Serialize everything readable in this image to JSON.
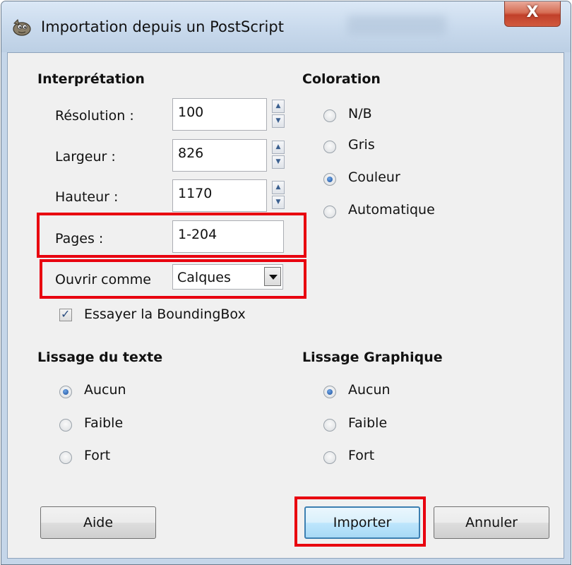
{
  "window": {
    "title": "Importation depuis un PostScript",
    "close_label": "X"
  },
  "interpretation": {
    "heading": "Interprétation",
    "resolution": {
      "label": "Résolution :",
      "value": "100"
    },
    "width": {
      "label": "Largeur :",
      "value": "826"
    },
    "height": {
      "label": "Hauteur :",
      "value": "1170"
    },
    "pages": {
      "label": "Pages :",
      "value": "1-204"
    },
    "open_as": {
      "label": "Ouvrir comme",
      "value": "Calques"
    },
    "bounding_box": {
      "label": "Essayer la BoundingBox",
      "checked": true
    }
  },
  "coloration": {
    "heading": "Coloration",
    "options": [
      "N/B",
      "Gris",
      "Couleur",
      "Automatique"
    ],
    "selected": "Couleur"
  },
  "text_smoothing": {
    "heading": "Lissage du texte",
    "options": [
      "Aucun",
      "Faible",
      "Fort"
    ],
    "selected": "Aucun"
  },
  "graphic_smoothing": {
    "heading": "Lissage Graphique",
    "options": [
      "Aucun",
      "Faible",
      "Fort"
    ],
    "selected": "Aucun"
  },
  "buttons": {
    "help": "Aide",
    "import": "Importer",
    "cancel": "Annuler"
  },
  "colors": {
    "highlight": "#e8000f",
    "accent": "#3c7fb1"
  }
}
